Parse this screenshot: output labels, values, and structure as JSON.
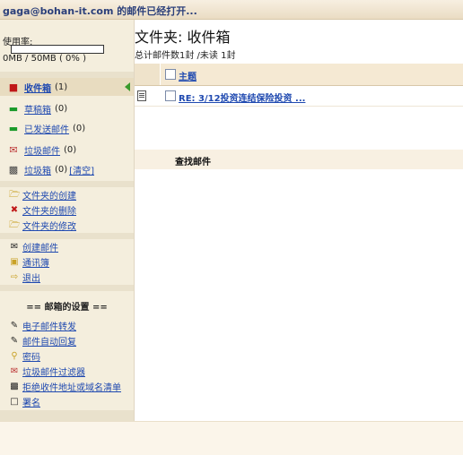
{
  "topbar": {
    "title": "gaga@bohan-it.com 的邮件已经打开..."
  },
  "sidebar": {
    "usage_label": "使用率:",
    "usage_value": "0MB / 50MB ( 0% )",
    "usage_fraction": 0,
    "mailboxes": [
      {
        "label": "收件箱",
        "count": "(1)",
        "icon": "inbox-icon",
        "selected": true
      },
      {
        "label": "草稿箱",
        "count": "(0)",
        "icon": "drafts-icon"
      },
      {
        "label": "已发送邮件",
        "count": "(0)",
        "icon": "sent-icon"
      },
      {
        "label": "垃圾邮件",
        "count": "(0)",
        "icon": "spam-icon"
      },
      {
        "label": "垃圾箱",
        "count": "(0)",
        "icon": "trash-icon",
        "extra": "[清空]"
      }
    ],
    "folder_actions": [
      {
        "label": "文件夹的创建",
        "icon": "folder-add-icon"
      },
      {
        "label": "文件夹的删除",
        "icon": "folder-delete-icon"
      },
      {
        "label": "文件夹的修改",
        "icon": "folder-edit-icon"
      }
    ],
    "actions": [
      {
        "label": "创建邮件",
        "icon": "compose-icon"
      },
      {
        "label": "通讯簿",
        "icon": "address-book-icon"
      },
      {
        "label": "退出",
        "icon": "logout-icon"
      }
    ],
    "settings_title": "== 邮箱的设置 ==",
    "settings": [
      {
        "label": "电子邮件转发",
        "icon": "forward-icon"
      },
      {
        "label": "邮件自动回复",
        "icon": "auto-reply-icon"
      },
      {
        "label": "密码",
        "icon": "key-icon"
      },
      {
        "label": "垃圾邮件过滤器",
        "icon": "spam-filter-icon"
      },
      {
        "label": "拒绝收件地址或域名清单",
        "icon": "blocklist-icon"
      },
      {
        "label": "署名",
        "icon": "signature-icon"
      }
    ]
  },
  "main": {
    "folder_title": "文件夹: 收件箱",
    "stats": "总计邮件数1封 /未读 1封",
    "column_subject": "主题",
    "messages": [
      {
        "subject": "RE: 3/12投资连结保险投资 ..."
      }
    ],
    "find_label": "查找邮件"
  },
  "colors": {
    "link": "#1f49b0",
    "sidebar_bg": "#f4eedd",
    "header_bg": "#f5e9d3"
  }
}
